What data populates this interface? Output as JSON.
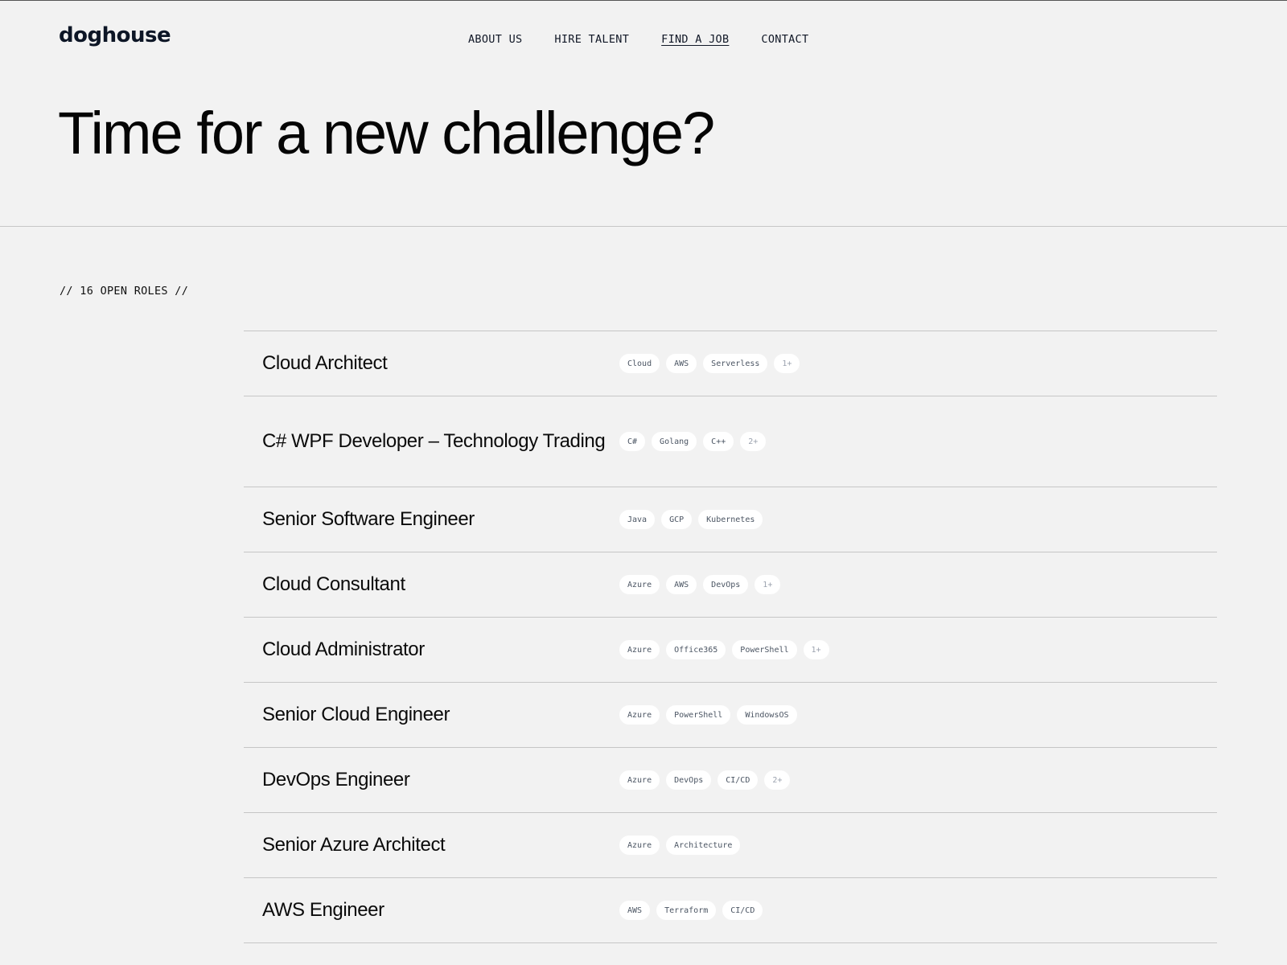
{
  "header": {
    "logo": "doghouse",
    "nav": [
      {
        "label": "ABOUT US",
        "active": false
      },
      {
        "label": "HIRE TALENT",
        "active": false
      },
      {
        "label": "FIND A JOB",
        "active": true
      },
      {
        "label": "CONTACT",
        "active": false
      }
    ]
  },
  "hero": {
    "title": "Time for a new challenge?"
  },
  "roles": {
    "count_label": "// 16 OPEN ROLES //",
    "jobs": [
      {
        "title": "Cloud Architect",
        "tags": [
          "Cloud",
          "AWS",
          "Serverless"
        ],
        "more": "1+"
      },
      {
        "title": "C# WPF Developer – Technology Trading",
        "tags": [
          "C#",
          "Golang",
          "C++"
        ],
        "more": "2+"
      },
      {
        "title": "Senior Software Engineer",
        "tags": [
          "Java",
          "GCP",
          "Kubernetes"
        ],
        "more": null
      },
      {
        "title": "Cloud Consultant",
        "tags": [
          "Azure",
          "AWS",
          "DevOps"
        ],
        "more": "1+"
      },
      {
        "title": "Cloud Administrator",
        "tags": [
          "Azure",
          "Office365",
          "PowerShell"
        ],
        "more": "1+"
      },
      {
        "title": "Senior Cloud Engineer",
        "tags": [
          "Azure",
          "PowerShell",
          "WindowsOS"
        ],
        "more": null
      },
      {
        "title": "DevOps Engineer",
        "tags": [
          "Azure",
          "DevOps",
          "CI/CD"
        ],
        "more": "2+"
      },
      {
        "title": "Senior Azure Architect",
        "tags": [
          "Azure",
          "Architecture"
        ],
        "more": null
      },
      {
        "title": "AWS Engineer",
        "tags": [
          "AWS",
          "Terraform",
          "CI/CD"
        ],
        "more": null
      }
    ]
  }
}
